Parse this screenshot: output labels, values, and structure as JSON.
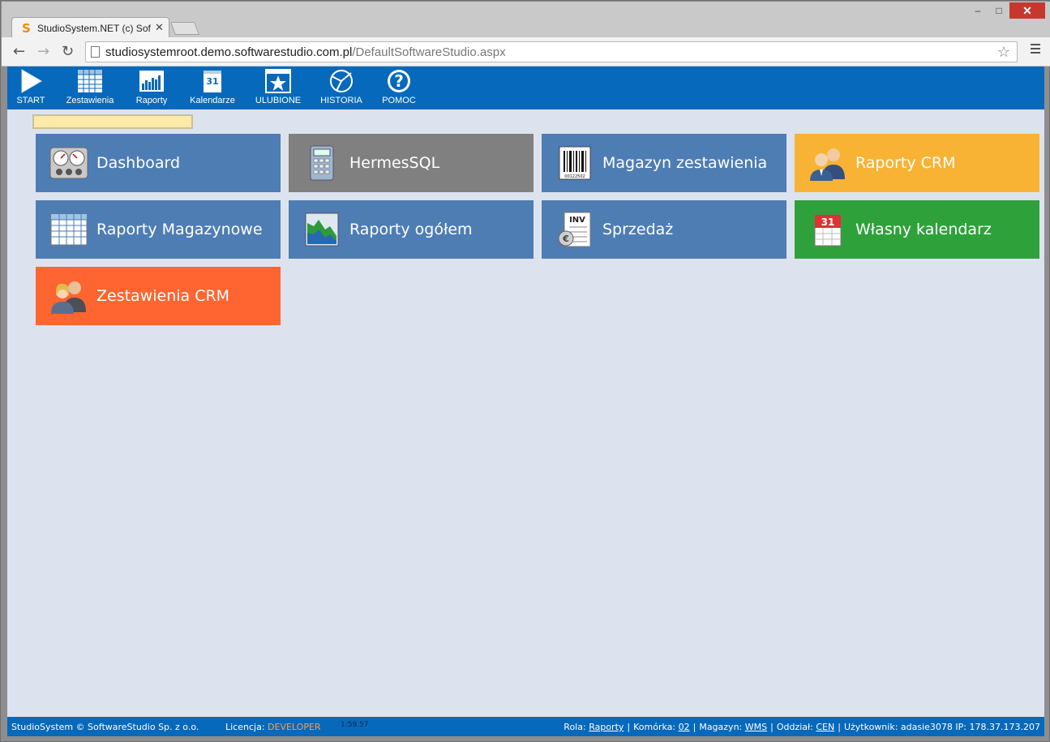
{
  "browser": {
    "tab_title": "StudioSystem.NET (c) Software",
    "tab_logo": "S",
    "url_host": "studiosystemroot.demo.softwarestudio.com.pl",
    "url_path": "/DefaultSoftwareStudio.aspx",
    "window_buttons": [
      "–",
      "□",
      "✕"
    ]
  },
  "appbar": {
    "items": [
      {
        "label": "START",
        "icon": "play-icon"
      },
      {
        "label": "Zestawienia",
        "icon": "table-icon"
      },
      {
        "label": "Raporty",
        "icon": "bar-chart-icon"
      },
      {
        "label": "Kalendarze",
        "icon": "calendar-icon"
      },
      {
        "label": "ULUBIONE",
        "icon": "star-icon"
      },
      {
        "label": "HISTORIA",
        "icon": "history-icon"
      },
      {
        "label": "POMOC",
        "icon": "help-icon"
      }
    ]
  },
  "search": {
    "value": ""
  },
  "tiles": [
    {
      "label": "Dashboard",
      "icon": "gauges-icon",
      "color": "#4e7db4"
    },
    {
      "label": "HermesSQL",
      "icon": "calculator-icon",
      "color": "#808080"
    },
    {
      "label": "Magazyn zestawienia",
      "icon": "barcode-icon",
      "color": "#4e7db4"
    },
    {
      "label": "Raporty CRM",
      "icon": "users-icon",
      "color": "#f8b334"
    },
    {
      "label": "Raporty Magazynowe",
      "icon": "table-icon",
      "color": "#4e7db4"
    },
    {
      "label": "Raporty ogółem",
      "icon": "area-chart-icon",
      "color": "#4e7db4"
    },
    {
      "label": "Sprzedaż",
      "icon": "invoice-icon",
      "color": "#4e7db4"
    },
    {
      "label": "Własny kalendarz",
      "icon": "calendar-icon",
      "color": "#2fa13a"
    },
    {
      "label": "Zestawienia CRM",
      "icon": "users-icon",
      "color": "#fe6530"
    }
  ],
  "status": {
    "copyright": "StudioSystem © SoftwareStudio Sp. z o.o.",
    "license_label": "Licencja:",
    "license_value": "DEVELOPER",
    "time": "1:59.57",
    "role_label": "Rola:",
    "role_value": "Raporty",
    "cell_label": "Komórka:",
    "cell_value": "02",
    "warehouse_label": "Magazyn:",
    "warehouse_value": "WMS",
    "branch_label": "Oddział:",
    "branch_value": "CEN",
    "user_label": "Użytkownik:",
    "user_value": "adasie3078",
    "ip_label": "IP:",
    "ip_value": "178.37.173.207"
  }
}
